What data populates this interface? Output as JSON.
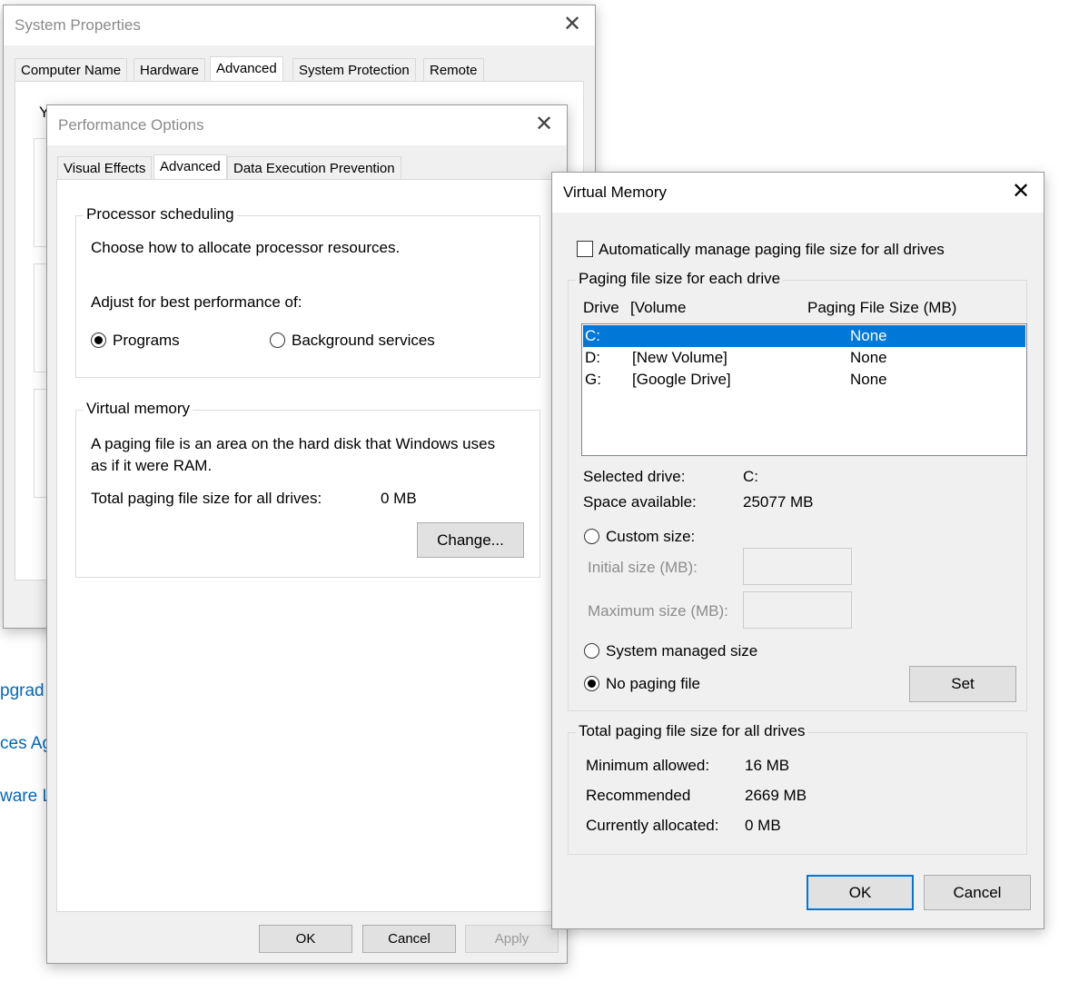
{
  "background_links": [
    "pgrad",
    "ces Ag",
    "ware Li"
  ],
  "system_properties": {
    "title": "System Properties",
    "tabs": [
      "Computer Name",
      "Hardware",
      "Advanced",
      "System Protection",
      "Remote"
    ],
    "selected_tab": "Advanced",
    "partial_text": "Y"
  },
  "performance_options": {
    "title": "Performance Options",
    "tabs": [
      "Visual Effects",
      "Advanced",
      "Data Execution Prevention"
    ],
    "selected_tab": "Advanced",
    "processor_scheduling": {
      "legend": "Processor scheduling",
      "description": "Choose how to allocate processor resources.",
      "adjust_label": "Adjust for best performance of:",
      "options": [
        "Programs",
        "Background services"
      ],
      "selected": "Programs"
    },
    "virtual_memory": {
      "legend": "Virtual memory",
      "description_line1": "A paging file is an area on the hard disk that Windows uses",
      "description_line2": "as if it were RAM.",
      "total_label": "Total paging file size for all drives:",
      "total_value": "0 MB",
      "change_button": "Change..."
    },
    "buttons": {
      "ok": "OK",
      "cancel": "Cancel",
      "apply": "Apply"
    }
  },
  "virtual_memory_dialog": {
    "title": "Virtual Memory",
    "auto_manage_label": "Automatically manage paging file size for all drives",
    "auto_manage_checked": false,
    "paging_group_legend": "Paging file size for each drive",
    "columns": {
      "drive": "Drive",
      "volume": "[Volume",
      "size": "Paging File Size (MB)"
    },
    "drives": [
      {
        "drive": "C:",
        "volume": "",
        "size": "None",
        "selected": true
      },
      {
        "drive": "D:",
        "volume": "[New Volume]",
        "size": "None",
        "selected": false
      },
      {
        "drive": "G:",
        "volume": "[Google Drive]",
        "size": "None",
        "selected": false
      }
    ],
    "selected_drive_label": "Selected drive:",
    "selected_drive_value": "C:",
    "space_available_label": "Space available:",
    "space_available_value": "25077 MB",
    "custom_size_label": "Custom size:",
    "initial_size_label": "Initial size (MB):",
    "initial_size_value": "",
    "maximum_size_label": "Maximum size (MB):",
    "maximum_size_value": "",
    "system_managed_label": "System managed size",
    "no_paging_label": "No paging file",
    "selected_option": "No paging file",
    "set_button": "Set",
    "total_group_legend": "Total paging file size for all drives",
    "minimum_label": "Minimum allowed:",
    "minimum_value": "16 MB",
    "recommended_label": "Recommended",
    "recommended_value": "2669 MB",
    "allocated_label": "Currently allocated:",
    "allocated_value": "0 MB",
    "ok_button": "OK",
    "cancel_button": "Cancel",
    "accent_color": "#0078d7"
  }
}
